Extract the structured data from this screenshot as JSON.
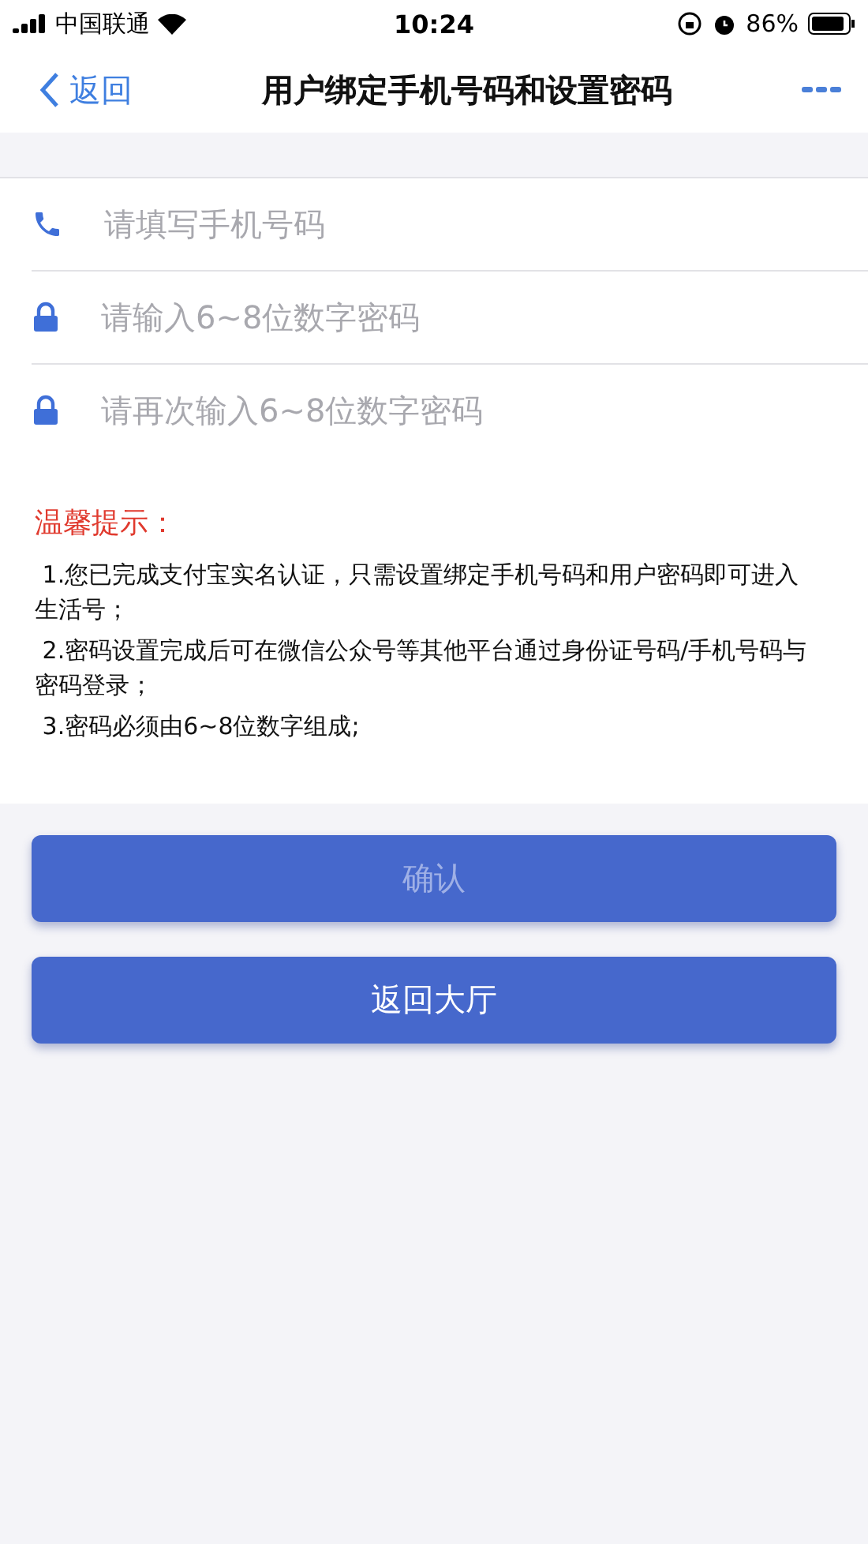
{
  "status_bar": {
    "carrier": "中国联通",
    "time": "10:24",
    "battery": "86%"
  },
  "nav": {
    "back": "返回",
    "title": "用户绑定手机号码和设置密码"
  },
  "fields": [
    {
      "kind": "phone",
      "placeholder": "请填写手机号码"
    },
    {
      "kind": "lock",
      "placeholder": "请输入6~8位数字密码"
    },
    {
      "kind": "lock",
      "placeholder": "请再次输入6~8位数字密码"
    }
  ],
  "tips": {
    "title": "温馨提示：",
    "items": [
      "1.您已完成支付宝实名认证，只需设置绑定手机号码和用户密码即可进入生活号；",
      "2.密码设置完成后可在微信公众号等其他平台通过身份证号码/手机号码与密码登录；",
      "3.密码必须由6~8位数字组成;"
    ]
  },
  "buttons": [
    {
      "label": "确认",
      "disabled": true
    },
    {
      "label": "返回大厅",
      "disabled": false
    }
  ]
}
